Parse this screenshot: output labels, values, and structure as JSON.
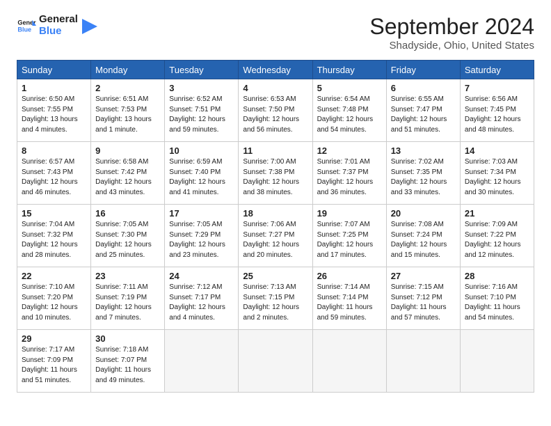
{
  "logo": {
    "text_general": "General",
    "text_blue": "Blue"
  },
  "title": "September 2024",
  "subtitle": "Shadyside, Ohio, United States",
  "days_of_week": [
    "Sunday",
    "Monday",
    "Tuesday",
    "Wednesday",
    "Thursday",
    "Friday",
    "Saturday"
  ],
  "weeks": [
    [
      {
        "day": "1",
        "detail": "Sunrise: 6:50 AM\nSunset: 7:55 PM\nDaylight: 13 hours\nand 4 minutes."
      },
      {
        "day": "2",
        "detail": "Sunrise: 6:51 AM\nSunset: 7:53 PM\nDaylight: 13 hours\nand 1 minute."
      },
      {
        "day": "3",
        "detail": "Sunrise: 6:52 AM\nSunset: 7:51 PM\nDaylight: 12 hours\nand 59 minutes."
      },
      {
        "day": "4",
        "detail": "Sunrise: 6:53 AM\nSunset: 7:50 PM\nDaylight: 12 hours\nand 56 minutes."
      },
      {
        "day": "5",
        "detail": "Sunrise: 6:54 AM\nSunset: 7:48 PM\nDaylight: 12 hours\nand 54 minutes."
      },
      {
        "day": "6",
        "detail": "Sunrise: 6:55 AM\nSunset: 7:47 PM\nDaylight: 12 hours\nand 51 minutes."
      },
      {
        "day": "7",
        "detail": "Sunrise: 6:56 AM\nSunset: 7:45 PM\nDaylight: 12 hours\nand 48 minutes."
      }
    ],
    [
      {
        "day": "8",
        "detail": "Sunrise: 6:57 AM\nSunset: 7:43 PM\nDaylight: 12 hours\nand 46 minutes."
      },
      {
        "day": "9",
        "detail": "Sunrise: 6:58 AM\nSunset: 7:42 PM\nDaylight: 12 hours\nand 43 minutes."
      },
      {
        "day": "10",
        "detail": "Sunrise: 6:59 AM\nSunset: 7:40 PM\nDaylight: 12 hours\nand 41 minutes."
      },
      {
        "day": "11",
        "detail": "Sunrise: 7:00 AM\nSunset: 7:38 PM\nDaylight: 12 hours\nand 38 minutes."
      },
      {
        "day": "12",
        "detail": "Sunrise: 7:01 AM\nSunset: 7:37 PM\nDaylight: 12 hours\nand 36 minutes."
      },
      {
        "day": "13",
        "detail": "Sunrise: 7:02 AM\nSunset: 7:35 PM\nDaylight: 12 hours\nand 33 minutes."
      },
      {
        "day": "14",
        "detail": "Sunrise: 7:03 AM\nSunset: 7:34 PM\nDaylight: 12 hours\nand 30 minutes."
      }
    ],
    [
      {
        "day": "15",
        "detail": "Sunrise: 7:04 AM\nSunset: 7:32 PM\nDaylight: 12 hours\nand 28 minutes."
      },
      {
        "day": "16",
        "detail": "Sunrise: 7:05 AM\nSunset: 7:30 PM\nDaylight: 12 hours\nand 25 minutes."
      },
      {
        "day": "17",
        "detail": "Sunrise: 7:05 AM\nSunset: 7:29 PM\nDaylight: 12 hours\nand 23 minutes."
      },
      {
        "day": "18",
        "detail": "Sunrise: 7:06 AM\nSunset: 7:27 PM\nDaylight: 12 hours\nand 20 minutes."
      },
      {
        "day": "19",
        "detail": "Sunrise: 7:07 AM\nSunset: 7:25 PM\nDaylight: 12 hours\nand 17 minutes."
      },
      {
        "day": "20",
        "detail": "Sunrise: 7:08 AM\nSunset: 7:24 PM\nDaylight: 12 hours\nand 15 minutes."
      },
      {
        "day": "21",
        "detail": "Sunrise: 7:09 AM\nSunset: 7:22 PM\nDaylight: 12 hours\nand 12 minutes."
      }
    ],
    [
      {
        "day": "22",
        "detail": "Sunrise: 7:10 AM\nSunset: 7:20 PM\nDaylight: 12 hours\nand 10 minutes."
      },
      {
        "day": "23",
        "detail": "Sunrise: 7:11 AM\nSunset: 7:19 PM\nDaylight: 12 hours\nand 7 minutes."
      },
      {
        "day": "24",
        "detail": "Sunrise: 7:12 AM\nSunset: 7:17 PM\nDaylight: 12 hours\nand 4 minutes."
      },
      {
        "day": "25",
        "detail": "Sunrise: 7:13 AM\nSunset: 7:15 PM\nDaylight: 12 hours\nand 2 minutes."
      },
      {
        "day": "26",
        "detail": "Sunrise: 7:14 AM\nSunset: 7:14 PM\nDaylight: 11 hours\nand 59 minutes."
      },
      {
        "day": "27",
        "detail": "Sunrise: 7:15 AM\nSunset: 7:12 PM\nDaylight: 11 hours\nand 57 minutes."
      },
      {
        "day": "28",
        "detail": "Sunrise: 7:16 AM\nSunset: 7:10 PM\nDaylight: 11 hours\nand 54 minutes."
      }
    ],
    [
      {
        "day": "29",
        "detail": "Sunrise: 7:17 AM\nSunset: 7:09 PM\nDaylight: 11 hours\nand 51 minutes."
      },
      {
        "day": "30",
        "detail": "Sunrise: 7:18 AM\nSunset: 7:07 PM\nDaylight: 11 hours\nand 49 minutes."
      },
      {
        "day": "",
        "detail": ""
      },
      {
        "day": "",
        "detail": ""
      },
      {
        "day": "",
        "detail": ""
      },
      {
        "day": "",
        "detail": ""
      },
      {
        "day": "",
        "detail": ""
      }
    ]
  ]
}
